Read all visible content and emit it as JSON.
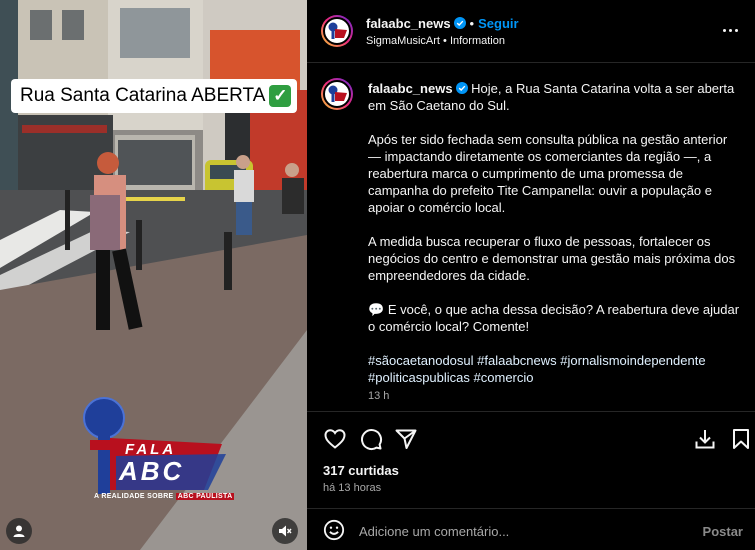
{
  "media": {
    "sticker_text": "Rua Santa Catarina ABERTA",
    "sticker_emoji": "✅",
    "logo": {
      "line1": "FALA",
      "line2": "ABC",
      "tagline_prefix": "A REALIDADE SOBRE",
      "tagline_highlight": "ABC PAULISTA"
    },
    "user_icon": "person-icon",
    "mute_icon": "speaker-muted-icon"
  },
  "header": {
    "username": "falaabc_news",
    "verified_icon": "verified-badge-icon",
    "separator": "•",
    "follow_label": "Seguir",
    "audio": "SigmaMusicArt",
    "audio_separator": "•",
    "location": "Information",
    "more_icon": "more-options-icon"
  },
  "caption": {
    "username": "falaabc_news",
    "intro": "Hoje, a Rua Santa Catarina volta a ser aberta em São Caetano do Sul.",
    "para1": "Após ter sido fechada sem consulta pública na gestão anterior — impactando diretamente os comerciantes da região —, a reabertura marca o cumprimento de uma promessa de campanha do prefeito Tite Campanella: ouvir a população e apoiar o comércio local.",
    "para2": "A medida busca recuperar o fluxo de pessoas, fortalecer os negócios do centro e demonstrar uma gestão mais próxima dos empreendedores da cidade.",
    "para3_emoji": "💬",
    "para3": "E você, o que acha dessa decisão? A reabertura deve ajudar o comércio local? Comente!",
    "hashtags": [
      "#sãocaetanodosul",
      "#falaabcnews",
      "#jornalismoindependente",
      "#politicaspublicas",
      "#comercio"
    ],
    "time": "13 h"
  },
  "actions": {
    "like_icon": "heart-icon",
    "comment_icon": "comment-icon",
    "share_icon": "send-icon",
    "download_icon": "download-icon",
    "save_icon": "bookmark-icon",
    "likes": "317 curtidas",
    "posted": "há 13 horas"
  },
  "comment_box": {
    "emoji_icon": "emoji-icon",
    "placeholder": "Adicione um comentário...",
    "post_label": "Postar"
  },
  "colors": {
    "accent": "#0095f6",
    "background": "#000000",
    "text": "#f5f5f5",
    "muted": "#a8a8a8",
    "logo_red": "#b8101e",
    "logo_blue": "#1f3f9a"
  }
}
